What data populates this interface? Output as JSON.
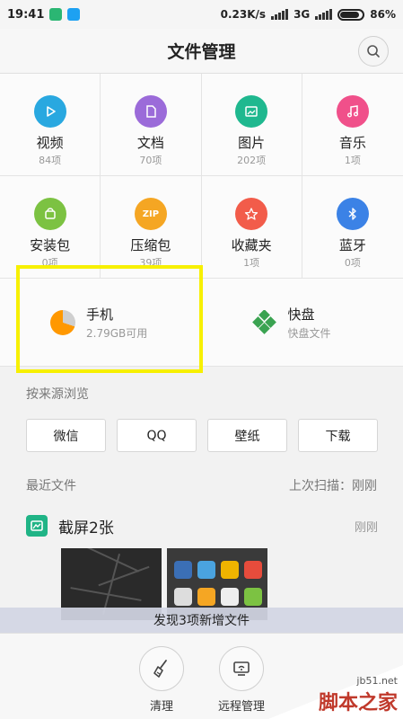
{
  "status_bar": {
    "time": "19:41",
    "network_speed": "0.23K/s",
    "network_type": "3G",
    "battery": "86%"
  },
  "header": {
    "title": "文件管理"
  },
  "categories": [
    {
      "label": "视频",
      "count": "84项",
      "color": "#29a8e0",
      "icon": "play-icon"
    },
    {
      "label": "文档",
      "count": "70项",
      "color": "#9b6bd9",
      "icon": "document-icon"
    },
    {
      "label": "图片",
      "count": "202项",
      "color": "#1fb88f",
      "icon": "image-icon"
    },
    {
      "label": "音乐",
      "count": "1项",
      "color": "#f0508a",
      "icon": "music-icon"
    },
    {
      "label": "安装包",
      "count": "0项",
      "color": "#7cc242",
      "icon": "package-icon"
    },
    {
      "label": "压缩包",
      "count": "39项",
      "color": "#f5a623",
      "icon": "zip-icon",
      "icon_text": "ZIP"
    },
    {
      "label": "收藏夹",
      "count": "1项",
      "color": "#f25c4a",
      "icon": "star-icon"
    },
    {
      "label": "蓝牙",
      "count": "0项",
      "color": "#3b82e6",
      "icon": "bluetooth-icon"
    }
  ],
  "storage": {
    "phone": {
      "title": "手机",
      "subtitle": "2.79GB可用",
      "used_fraction": 0.7
    },
    "kuaipan": {
      "title": "快盘",
      "subtitle": "快盘文件"
    }
  },
  "browse_by_source": {
    "label": "按来源浏览",
    "sources": [
      "微信",
      "QQ",
      "壁纸",
      "下载"
    ]
  },
  "recent": {
    "label": "最近文件",
    "last_scan": "上次扫描：刚刚",
    "group_title": "截屏2张",
    "group_time": "刚刚",
    "new_files_notice": "发现3项新增文件"
  },
  "bottom_bar": {
    "clean_label": "清理",
    "remote_label": "远程管理"
  },
  "watermark": {
    "url": "jb51.net",
    "text": "脚本之家"
  },
  "colors": {
    "highlight": "#f7f000",
    "accent": "#20b486"
  }
}
